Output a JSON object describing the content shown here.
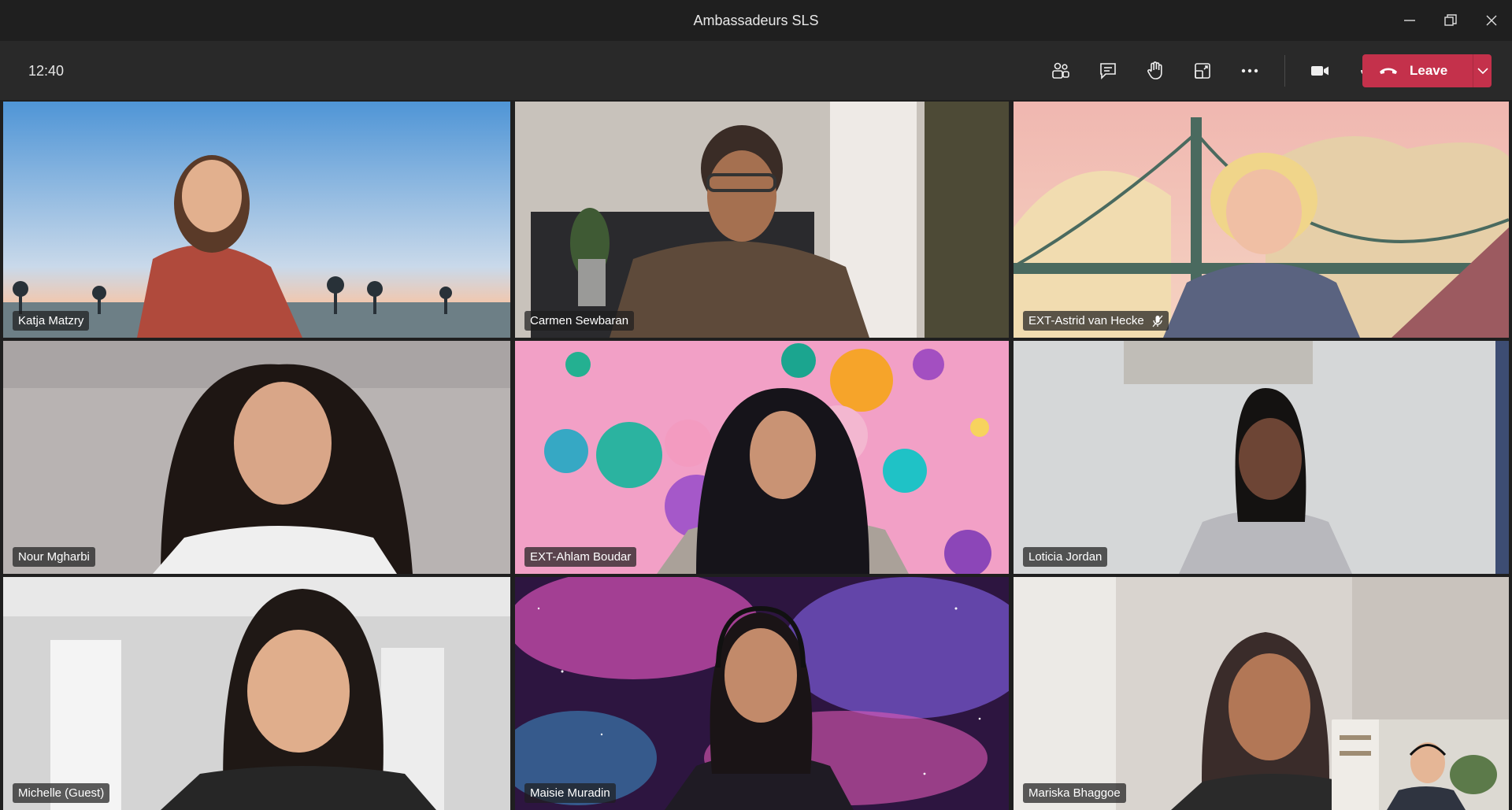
{
  "window": {
    "title": "Ambassadeurs SLS"
  },
  "toolbar": {
    "time": "12:40",
    "buttons": [
      {
        "name": "show-participants",
        "icon": "people-icon"
      },
      {
        "name": "show-conversation",
        "icon": "chat-icon"
      },
      {
        "name": "raise-hand",
        "icon": "hand-icon"
      },
      {
        "name": "breakout-rooms",
        "icon": "rooms-icon"
      },
      {
        "name": "more-actions",
        "icon": "more-icon"
      },
      {
        "name": "camera",
        "icon": "camera-icon"
      },
      {
        "name": "microphone",
        "icon": "mic-icon"
      },
      {
        "name": "share-content",
        "icon": "share-icon"
      }
    ],
    "leave_label": "Leave"
  },
  "participants": [
    {
      "name": "Katja Matzry",
      "muted": false,
      "bg": "#7eb1de"
    },
    {
      "name": "Carmen Sewbaran",
      "muted": false,
      "bg": "#b9b2aa"
    },
    {
      "name": "EXT-Astrid van Hecke",
      "muted": true,
      "bg": "#eec0b4"
    },
    {
      "name": "Nour Mgharbi",
      "muted": false,
      "bg": "#b6b3b2"
    },
    {
      "name": "EXT-Ahlam Boudar",
      "muted": false,
      "bg": "#f3a1c8"
    },
    {
      "name": "Loticia Jordan",
      "muted": false,
      "bg": "#d5d6d6"
    },
    {
      "name": "Michelle (Guest)",
      "muted": false,
      "bg": "#c9c9c9"
    },
    {
      "name": "Maisie Muradin",
      "muted": false,
      "bg": "#5a1d5a"
    },
    {
      "name": "Mariska Bhaggoe",
      "muted": false,
      "bg": "#d9d4cf"
    }
  ],
  "colors": {
    "leave": "#c4314b",
    "toolbar": "#292929",
    "titlebar": "#1f1f1f"
  }
}
